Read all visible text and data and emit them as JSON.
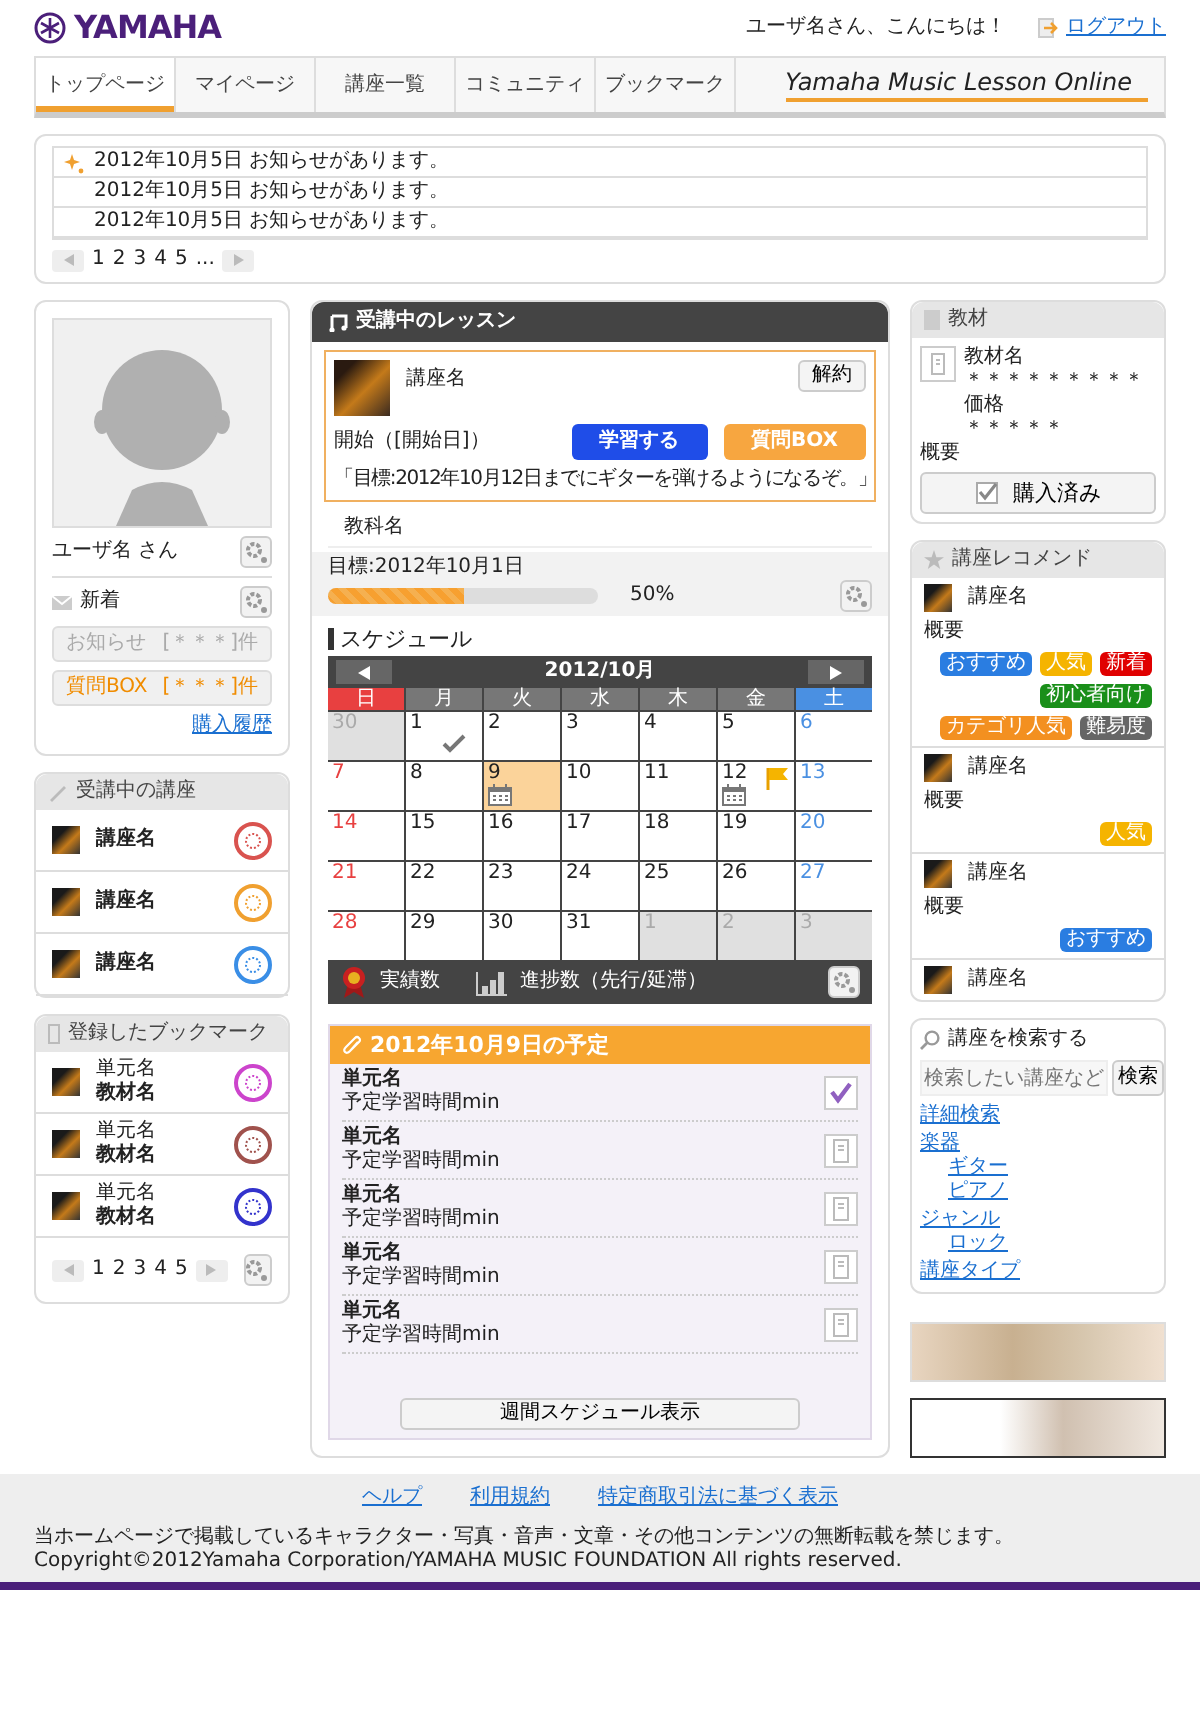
{
  "header": {
    "logo": "YAMAHA",
    "greeting": "ユーザ名さん、こんにちは！",
    "logout": "ログアウト"
  },
  "tabs": [
    {
      "label": "トップページ",
      "selected": true
    },
    {
      "label": "マイページ",
      "selected": false
    },
    {
      "label": "講座一覧",
      "selected": false
    },
    {
      "label": "コミュニティ",
      "selected": false
    },
    {
      "label": "ブックマーク",
      "selected": false
    }
  ],
  "brand": "Yamaha Music Lesson Online",
  "notices": {
    "items": [
      {
        "text": "2012年10月5日 お知らせがあります。",
        "new": true
      },
      {
        "text": "2012年10月5日 お知らせがあります。",
        "new": false
      },
      {
        "text": "2012年10月5日 お知らせがあります。",
        "new": false
      }
    ],
    "pages": [
      "1",
      "2",
      "3",
      "4",
      "5",
      "..."
    ]
  },
  "profile": {
    "name": "ユーザ名 さん",
    "new_label": "新着",
    "buttons": [
      {
        "label": "お知らせ",
        "count": "[＊＊＊]件",
        "disabled": true
      },
      {
        "label": "質問BOX",
        "count": "[＊＊＊]件",
        "disabled": false
      }
    ],
    "history_link": "購入履歴"
  },
  "courses": {
    "title": "受講中の講座",
    "items": [
      {
        "name": "講座名",
        "color": "#d9534f"
      },
      {
        "name": "講座名",
        "color": "#f0a030"
      },
      {
        "name": "講座名",
        "color": "#3a8ee6"
      }
    ]
  },
  "bookmarks": {
    "title": "登録したブックマーク",
    "items": [
      {
        "unit": "単元名",
        "material": "教材名",
        "color": "#cc44cc"
      },
      {
        "unit": "単元名",
        "material": "教材名",
        "color": "#a0524d"
      },
      {
        "unit": "単元名",
        "material": "教材名",
        "color": "#3333cc"
      }
    ],
    "pages": [
      "1",
      "2",
      "3",
      "4",
      "5"
    ]
  },
  "lesson": {
    "title": "受講中のレッスン",
    "course": "講座名",
    "cancel": "解約",
    "start": "開始（[開始日]）",
    "study": "学習する",
    "question": "質問BOX",
    "goal": "「目標:2012年10月12日までにギターを弾けるようになるぞ。」",
    "subject": "教科名",
    "target": "目標:2012年10月1日",
    "level": 0.5,
    "percent": "50%"
  },
  "schedule": {
    "title": "スケジュール",
    "month": "2012/10月",
    "weekdays": [
      "日",
      "月",
      "火",
      "水",
      "木",
      "金",
      "土"
    ],
    "weeks": [
      [
        {
          "day": "30",
          "other_month": true,
          "selected": false,
          "done": false,
          "event": false,
          "flag": false
        },
        {
          "day": "1",
          "other_month": false,
          "selected": false,
          "done": true,
          "event": false,
          "flag": false
        },
        {
          "day": "2",
          "other_month": false,
          "selected": false,
          "done": false,
          "event": false,
          "flag": false
        },
        {
          "day": "3",
          "other_month": false,
          "selected": false,
          "done": false,
          "event": false,
          "flag": false
        },
        {
          "day": "4",
          "other_month": false,
          "selected": false,
          "done": false,
          "event": false,
          "flag": false
        },
        {
          "day": "5",
          "other_month": false,
          "selected": false,
          "done": false,
          "event": false,
          "flag": false
        },
        {
          "day": "6",
          "other_month": false,
          "selected": false,
          "done": false,
          "event": false,
          "flag": false
        }
      ],
      [
        {
          "day": "7",
          "other_month": false,
          "selected": false,
          "done": false,
          "event": false,
          "flag": false
        },
        {
          "day": "8",
          "other_month": false,
          "selected": false,
          "done": false,
          "event": false,
          "flag": false
        },
        {
          "day": "9",
          "other_month": false,
          "selected": true,
          "done": false,
          "event": true,
          "flag": false
        },
        {
          "day": "10",
          "other_month": false,
          "selected": false,
          "done": false,
          "event": false,
          "flag": false
        },
        {
          "day": "11",
          "other_month": false,
          "selected": false,
          "done": false,
          "event": false,
          "flag": false
        },
        {
          "day": "12",
          "other_month": false,
          "selected": false,
          "done": false,
          "event": true,
          "flag": true
        },
        {
          "day": "13",
          "other_month": false,
          "selected": false,
          "done": false,
          "event": false,
          "flag": false
        }
      ],
      [
        {
          "day": "14",
          "other_month": false,
          "selected": false,
          "done": false,
          "event": false,
          "flag": false
        },
        {
          "day": "15",
          "other_month": false,
          "selected": false,
          "done": false,
          "event": false,
          "flag": false
        },
        {
          "day": "16",
          "other_month": false,
          "selected": false,
          "done": false,
          "event": false,
          "flag": false
        },
        {
          "day": "17",
          "other_month": false,
          "selected": false,
          "done": false,
          "event": false,
          "flag": false
        },
        {
          "day": "18",
          "other_month": false,
          "selected": false,
          "done": false,
          "event": false,
          "flag": false
        },
        {
          "day": "19",
          "other_month": false,
          "selected": false,
          "done": false,
          "event": false,
          "flag": false
        },
        {
          "day": "20",
          "other_month": false,
          "selected": false,
          "done": false,
          "event": false,
          "flag": false
        }
      ],
      [
        {
          "day": "21",
          "other_month": false,
          "selected": false,
          "done": false,
          "event": false,
          "flag": false
        },
        {
          "day": "22",
          "other_month": false,
          "selected": false,
          "done": false,
          "event": false,
          "flag": false
        },
        {
          "day": "23",
          "other_month": false,
          "selected": false,
          "done": false,
          "event": false,
          "flag": false
        },
        {
          "day": "24",
          "other_month": false,
          "selected": false,
          "done": false,
          "event": false,
          "flag": false
        },
        {
          "day": "25",
          "other_month": false,
          "selected": false,
          "done": false,
          "event": false,
          "flag": false
        },
        {
          "day": "26",
          "other_month": false,
          "selected": false,
          "done": false,
          "event": false,
          "flag": false
        },
        {
          "day": "27",
          "other_month": false,
          "selected": false,
          "done": false,
          "event": false,
          "flag": false
        }
      ],
      [
        {
          "day": "28",
          "other_month": false,
          "selected": false,
          "done": false,
          "event": false,
          "flag": false
        },
        {
          "day": "29",
          "other_month": false,
          "selected": false,
          "done": false,
          "event": false,
          "flag": false
        },
        {
          "day": "30",
          "other_month": false,
          "selected": false,
          "done": false,
          "event": false,
          "flag": false
        },
        {
          "day": "31",
          "other_month": false,
          "selected": false,
          "done": false,
          "event": false,
          "flag": false
        },
        {
          "day": "1",
          "other_month": true,
          "selected": false,
          "done": false,
          "event": false,
          "flag": false
        },
        {
          "day": "2",
          "other_month": true,
          "selected": false,
          "done": false,
          "event": false,
          "flag": false
        },
        {
          "day": "3",
          "other_month": true,
          "selected": false,
          "done": false,
          "event": false,
          "flag": false
        }
      ]
    ],
    "achievements": "実績数",
    "progress": "進捗数（先行/延滞）"
  },
  "plan": {
    "title": "2012年10月9日の予定",
    "items": [
      {
        "unit": "単元名",
        "time": "予定学習時間min",
        "done": true
      },
      {
        "unit": "単元名",
        "time": "予定学習時間min",
        "done": false
      },
      {
        "unit": "単元名",
        "time": "予定学習時間min",
        "done": false
      },
      {
        "unit": "単元名",
        "time": "予定学習時間min",
        "done": false
      },
      {
        "unit": "単元名",
        "time": "予定学習時間min",
        "done": false
      }
    ],
    "button": "週間スケジュール表示"
  },
  "material": {
    "title": "教材",
    "name_label": "教材名",
    "name": "＊＊＊＊＊＊＊＊＊",
    "price_label": "価格",
    "price": "＊＊＊＊＊",
    "summary": "概要",
    "purchased": {
      "label": "購入済み",
      "checked": true
    }
  },
  "recommend": {
    "title": "講座レコメンド",
    "items": [
      {
        "name": "講座名",
        "summary": "概要",
        "tags": [
          {
            "label": "おすすめ",
            "color": "#2a7de1"
          },
          {
            "label": "人気",
            "color": "#f5b400"
          },
          {
            "label": "新着",
            "color": "#e00000"
          },
          {
            "label": "初心者向け",
            "color": "#1a8f1a"
          },
          {
            "label": "カテゴリ人気",
            "color": "#f39020"
          },
          {
            "label": "難易度",
            "color": "#666666"
          }
        ]
      },
      {
        "name": "講座名",
        "summary": "概要",
        "tags": [
          {
            "label": "人気",
            "color": "#f5b400"
          }
        ]
      },
      {
        "name": "講座名",
        "summary": "概要",
        "tags": [
          {
            "label": "おすすめ",
            "color": "#2a7de1"
          }
        ]
      },
      {
        "name": "講座名"
      }
    ]
  },
  "search": {
    "title": "講座を検索する",
    "placeholder": "検索したい講座など",
    "button": "検索",
    "links": [
      {
        "label": "詳細検索"
      },
      {
        "label": "楽器",
        "children": [
          {
            "label": "ギター"
          },
          {
            "label": "ピアノ"
          }
        ]
      },
      {
        "label": "ジャンル",
        "children": [
          {
            "label": "ロック"
          }
        ]
      },
      {
        "label": "講座タイプ"
      }
    ]
  },
  "footer": {
    "links": [
      "ヘルプ",
      "利用規約",
      "特定商取引法に基づく表示"
    ],
    "notice": "当ホームページで掲載しているキャラクター・写真・音声・文章・その他コンテンツの無断転載を禁じます。",
    "copyright": "Copyright©2012Yamaha Corporation/YAMAHA MUSIC FOUNDATION All rights reserved."
  }
}
